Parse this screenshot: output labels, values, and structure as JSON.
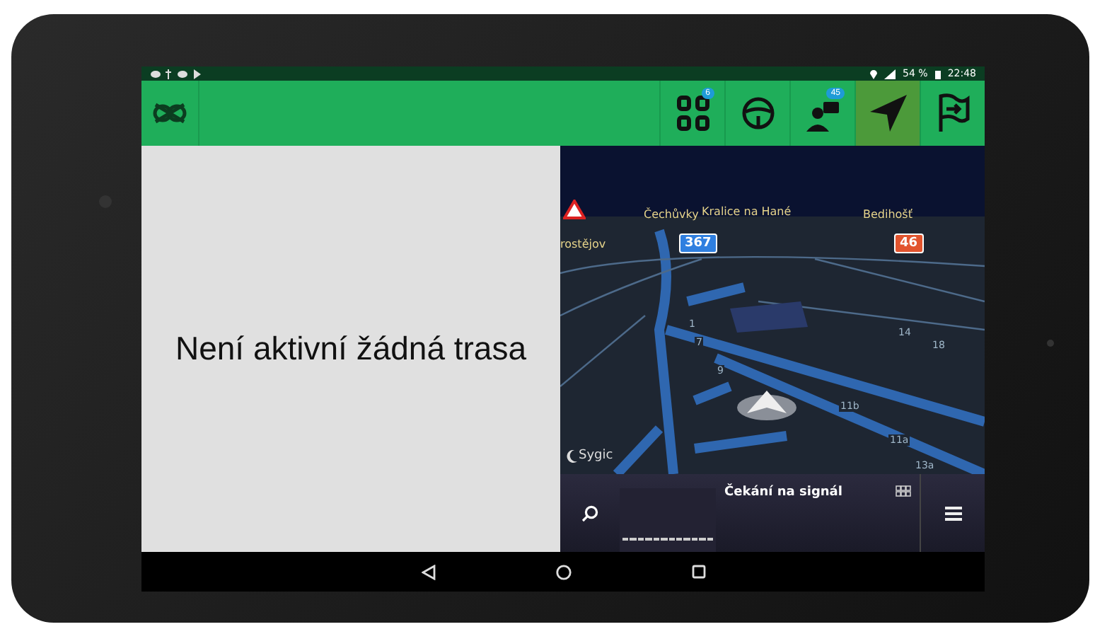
{
  "status_bar": {
    "battery": "54 %",
    "time": "22:48"
  },
  "toolbar": {
    "tabs": [
      {
        "kind": "dashboard",
        "badge": "6",
        "selected": false
      },
      {
        "kind": "steering",
        "selected": false
      },
      {
        "kind": "messages",
        "badge": "45",
        "selected": false
      },
      {
        "kind": "navigation",
        "selected": true
      },
      {
        "kind": "flag",
        "selected": false
      }
    ]
  },
  "left_panel": {
    "message": "Není aktivní žádná trasa"
  },
  "map": {
    "labels": [
      {
        "text": "Čechůvky",
        "kind": "town"
      },
      {
        "text": "Kralice na Hané",
        "kind": "town"
      },
      {
        "text": "Bedihošť",
        "kind": "town"
      },
      {
        "text": "rostějov",
        "kind": "town"
      },
      {
        "text": "1",
        "kind": "number"
      },
      {
        "text": "7",
        "kind": "number"
      },
      {
        "text": "9",
        "kind": "number"
      },
      {
        "text": "14",
        "kind": "number"
      },
      {
        "text": "18",
        "kind": "number"
      },
      {
        "text": "11b",
        "kind": "number"
      },
      {
        "text": "11a",
        "kind": "number"
      },
      {
        "text": "13a",
        "kind": "number"
      }
    ],
    "road_shields": [
      {
        "text": "367",
        "color": "#2f7fe0"
      },
      {
        "text": "46",
        "color": "#e2542e"
      }
    ],
    "attribution": "Sygic",
    "bottom_bar": {
      "status": "Čekání na signál"
    }
  }
}
